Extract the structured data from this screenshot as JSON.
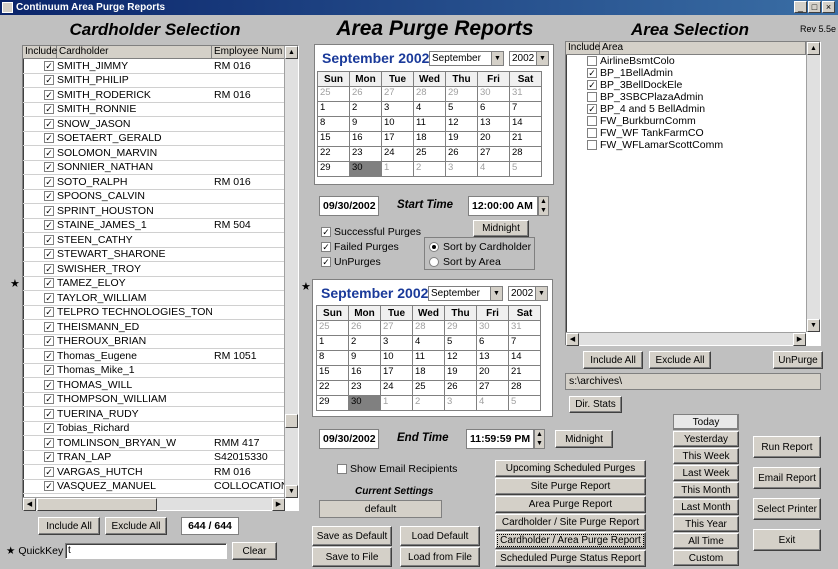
{
  "window": {
    "title": "Continuum Area Purge Reports",
    "rev": "Rev 5.5e",
    "min": "_",
    "max": "□",
    "close": "×"
  },
  "headings": {
    "cardholder": "Cardholder Selection",
    "reports": "Area Purge Reports",
    "area": "Area Selection"
  },
  "cardholders": {
    "columns": [
      "Include",
      "Cardholder",
      "Employee Num"
    ],
    "rows": [
      {
        "name": "SMITH_JIMMY",
        "emp": "RM 016"
      },
      {
        "name": "SMITH_PHILIP",
        "emp": ""
      },
      {
        "name": "SMITH_RODERICK",
        "emp": "RM 016"
      },
      {
        "name": "SMITH_RONNIE",
        "emp": ""
      },
      {
        "name": "SNOW_JASON",
        "emp": ""
      },
      {
        "name": "SOETAERT_GERALD",
        "emp": ""
      },
      {
        "name": "SOLOMON_MARVIN",
        "emp": ""
      },
      {
        "name": "SONNIER_NATHAN",
        "emp": ""
      },
      {
        "name": "SOTO_RALPH",
        "emp": "RM 016"
      },
      {
        "name": "SPOONS_CALVIN",
        "emp": ""
      },
      {
        "name": "SPRINT_HOUSTON",
        "emp": ""
      },
      {
        "name": "STAINE_JAMES_1",
        "emp": "RM 504"
      },
      {
        "name": "STEEN_CATHY",
        "emp": ""
      },
      {
        "name": "STEWART_SHARONE",
        "emp": ""
      },
      {
        "name": "SWISHER_TROY",
        "emp": ""
      },
      {
        "name": "TAMEZ_ELOY",
        "emp": ""
      },
      {
        "name": "TAYLOR_WILLIAM",
        "emp": ""
      },
      {
        "name": "TELPRO TECHNOLOGIES_TON",
        "emp": ""
      },
      {
        "name": "THEISMANN_ED",
        "emp": ""
      },
      {
        "name": "THEROUX_BRIAN",
        "emp": ""
      },
      {
        "name": "Thomas_Eugene",
        "emp": "RM 1051"
      },
      {
        "name": "Thomas_Mike_1",
        "emp": ""
      },
      {
        "name": "THOMAS_WILL",
        "emp": ""
      },
      {
        "name": "THOMPSON_WILLIAM",
        "emp": ""
      },
      {
        "name": "TUERINA_RUDY",
        "emp": ""
      },
      {
        "name": "Tobias_Richard",
        "emp": ""
      },
      {
        "name": "TOMLINSON_BRYAN_W",
        "emp": "RMM 417"
      },
      {
        "name": "TRAN_LAP",
        "emp": "S42015330"
      },
      {
        "name": "VARGAS_HUTCH",
        "emp": "RM 016"
      },
      {
        "name": "VASQUEZ_MANUEL",
        "emp": "COLLOCATION"
      }
    ],
    "check": "☑",
    "include_all": "Include All",
    "exclude_all": "Exclude All",
    "count": "644 / 644",
    "quickkey_label": "QuickKey",
    "quickkey_value": "t",
    "clear": "Clear",
    "star": "★"
  },
  "start_cal": {
    "title": "September 2002",
    "month": "September",
    "year": "2002",
    "days": [
      "Sun",
      "Mon",
      "Tue",
      "Wed",
      "Thu",
      "Fri",
      "Sat"
    ],
    "weeks": [
      [
        "25",
        "26",
        "27",
        "28",
        "29",
        "30",
        "31"
      ],
      [
        "1",
        "2",
        "3",
        "4",
        "5",
        "6",
        "7"
      ],
      [
        "8",
        "9",
        "10",
        "11",
        "12",
        "13",
        "14"
      ],
      [
        "15",
        "16",
        "17",
        "18",
        "19",
        "20",
        "21"
      ],
      [
        "22",
        "23",
        "24",
        "25",
        "26",
        "27",
        "28"
      ],
      [
        "29",
        "30",
        "1",
        "2",
        "3",
        "4",
        "5"
      ]
    ]
  },
  "start": {
    "date": "09/30/2002",
    "label": "Start Time",
    "time": "12:00:00 AM",
    "midnight": "Midnight"
  },
  "options": {
    "successful": "Successful Purges",
    "failed": "Failed Purges",
    "unpurges": "UnPurges",
    "sort_cardholder": "Sort by Cardholder",
    "sort_area": "Sort by Area"
  },
  "end": {
    "date": "09/30/2002",
    "label": "End Time",
    "time": "11:59:59 PM",
    "midnight": "Midnight"
  },
  "settings": {
    "show_email": "Show Email Recipients",
    "current_label": "Current Settings",
    "current_value": "default",
    "save_default": "Save as Default",
    "load_default": "Load Default",
    "save_file": "Save to File",
    "load_file": "Load from File"
  },
  "reports": [
    "Upcoming Scheduled Purges",
    "Site Purge Report",
    "Area Purge Report",
    "Cardholder / Site Purge Report",
    "Cardholder / Area Purge Report",
    "Scheduled Purge Status Report"
  ],
  "ranges": [
    "Today",
    "Yesterday",
    "This Week",
    "Last Week",
    "This Month",
    "Last Month",
    "This Year",
    "All Time",
    "Custom"
  ],
  "actions": {
    "run": "Run Report",
    "email": "Email Report",
    "printer": "Select Printer",
    "exit": "Exit"
  },
  "areas": {
    "columns": [
      "Include",
      "Area"
    ],
    "rows": [
      {
        "name": "AirlineBsmtColo",
        "checked": false
      },
      {
        "name": "BP_1BellAdmin",
        "checked": true
      },
      {
        "name": "BP_3BellDockEle",
        "checked": true
      },
      {
        "name": "BP_3SBCPlazaAdmin",
        "checked": false
      },
      {
        "name": "BP_4 and 5 BellAdmin",
        "checked": true
      },
      {
        "name": "FW_BurkburnComm",
        "checked": false
      },
      {
        "name": "FW_WF TankFarmCO",
        "checked": false
      },
      {
        "name": "FW_WFLamarScottComm",
        "checked": false
      }
    ],
    "include_all": "Include All",
    "exclude_all": "Exclude All",
    "unpurge": "UnPurge",
    "archive_path": "s:\\archives\\",
    "dir_stats": "Dir. Stats"
  }
}
